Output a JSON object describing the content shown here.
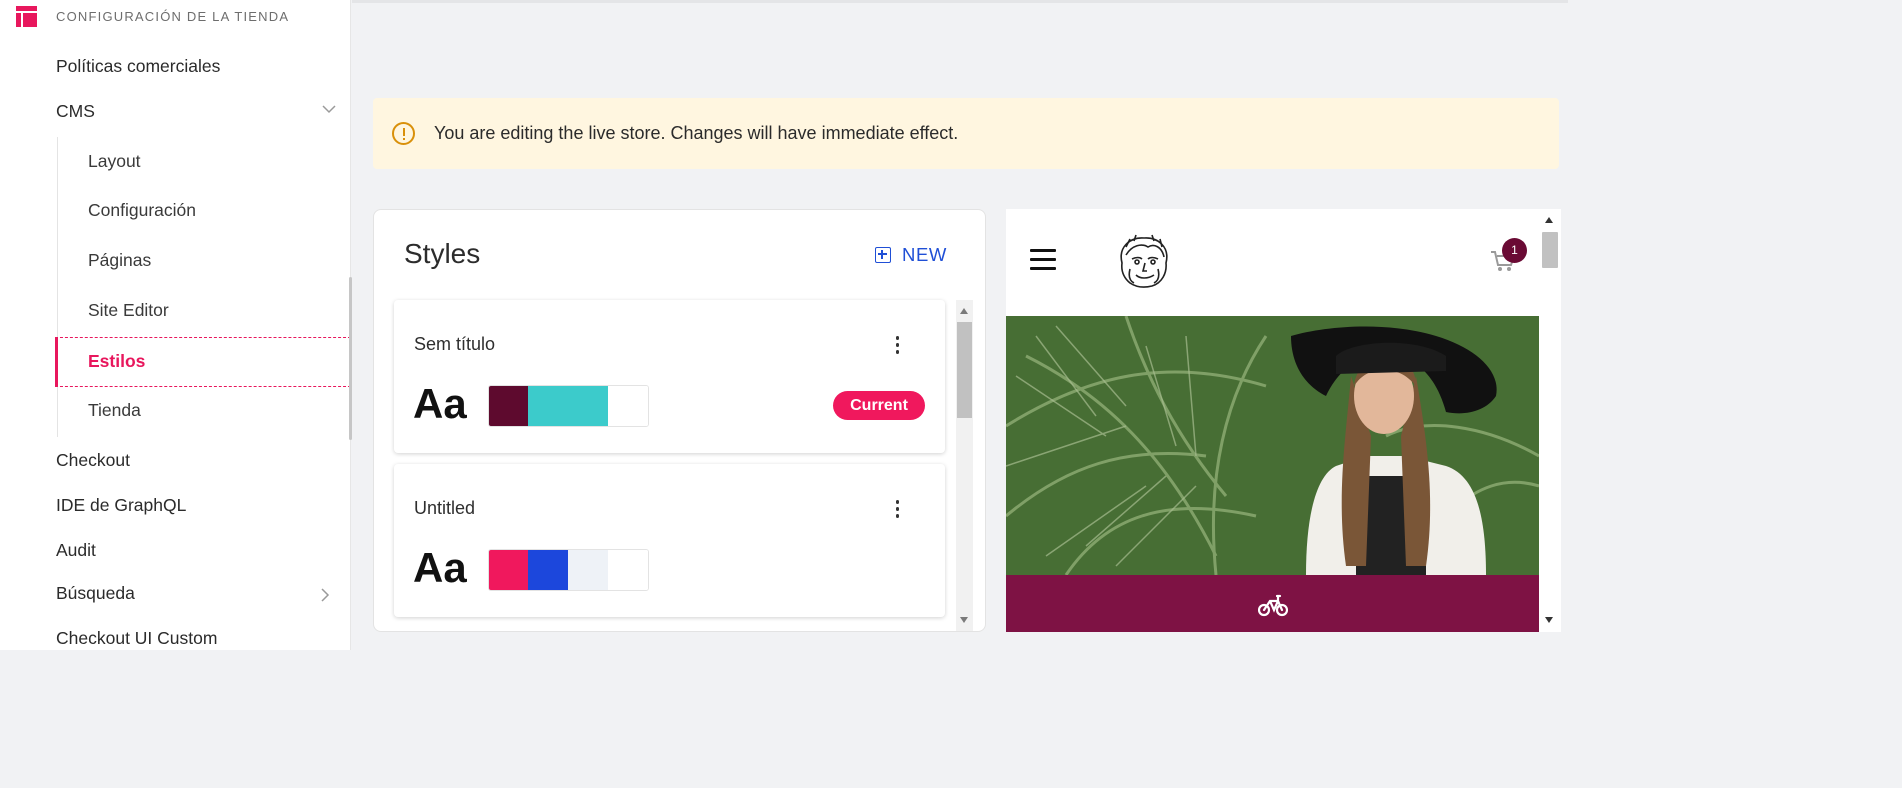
{
  "sidebar": {
    "header_title": "CONFIGURACIÓN DE LA TIENDA",
    "items": {
      "politicas": "Políticas comerciales",
      "cms": "CMS",
      "checkout": "Checkout",
      "graphql": "IDE de GraphQL",
      "audit": "Audit",
      "busqueda": "Búsqueda",
      "checkout_ui": "Checkout UI Custom"
    },
    "cms_sub": {
      "layout": "Layout",
      "configuracion": "Configuración",
      "paginas": "Páginas",
      "site_editor": "Site Editor",
      "estilos": "Estilos",
      "tienda": "Tienda"
    },
    "active_item": "Estilos",
    "accent_color": "#e8175d"
  },
  "alert": {
    "message": "You are editing the live store. Changes will have immediate effect.",
    "icon": "warning-circle-icon"
  },
  "styles_panel": {
    "title": "Styles",
    "new_label": "NEW",
    "cards": [
      {
        "name": "Sem título",
        "typography_sample": "Aa",
        "colors": [
          "#5e0a2e",
          "#3ccbcb",
          "#ffffff"
        ],
        "badge": "Current"
      },
      {
        "name": "Untitled",
        "typography_sample": "Aa",
        "colors": [
          "#f0185d",
          "#1c47dc",
          "#eef2f7",
          "#ffffff"
        ]
      }
    ]
  },
  "preview": {
    "cart_count": "1",
    "header_icons": [
      "menu-icon",
      "brand-logo",
      "cart-icon"
    ],
    "bottom_bar_icon": "bicycle-icon",
    "bottom_bar_color": "#7e1244"
  }
}
